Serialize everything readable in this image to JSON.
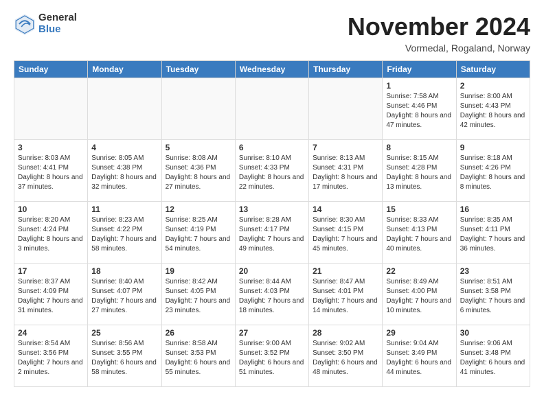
{
  "header": {
    "logo_general": "General",
    "logo_blue": "Blue",
    "month_title": "November 2024",
    "location": "Vormedal, Rogaland, Norway"
  },
  "days_of_week": [
    "Sunday",
    "Monday",
    "Tuesday",
    "Wednesday",
    "Thursday",
    "Friday",
    "Saturday"
  ],
  "weeks": [
    [
      {
        "day": "",
        "info": ""
      },
      {
        "day": "",
        "info": ""
      },
      {
        "day": "",
        "info": ""
      },
      {
        "day": "",
        "info": ""
      },
      {
        "day": "",
        "info": ""
      },
      {
        "day": "1",
        "info": "Sunrise: 7:58 AM\nSunset: 4:46 PM\nDaylight: 8 hours\nand 47 minutes."
      },
      {
        "day": "2",
        "info": "Sunrise: 8:00 AM\nSunset: 4:43 PM\nDaylight: 8 hours\nand 42 minutes."
      }
    ],
    [
      {
        "day": "3",
        "info": "Sunrise: 8:03 AM\nSunset: 4:41 PM\nDaylight: 8 hours\nand 37 minutes."
      },
      {
        "day": "4",
        "info": "Sunrise: 8:05 AM\nSunset: 4:38 PM\nDaylight: 8 hours\nand 32 minutes."
      },
      {
        "day": "5",
        "info": "Sunrise: 8:08 AM\nSunset: 4:36 PM\nDaylight: 8 hours\nand 27 minutes."
      },
      {
        "day": "6",
        "info": "Sunrise: 8:10 AM\nSunset: 4:33 PM\nDaylight: 8 hours\nand 22 minutes."
      },
      {
        "day": "7",
        "info": "Sunrise: 8:13 AM\nSunset: 4:31 PM\nDaylight: 8 hours\nand 17 minutes."
      },
      {
        "day": "8",
        "info": "Sunrise: 8:15 AM\nSunset: 4:28 PM\nDaylight: 8 hours\nand 13 minutes."
      },
      {
        "day": "9",
        "info": "Sunrise: 8:18 AM\nSunset: 4:26 PM\nDaylight: 8 hours\nand 8 minutes."
      }
    ],
    [
      {
        "day": "10",
        "info": "Sunrise: 8:20 AM\nSunset: 4:24 PM\nDaylight: 8 hours\nand 3 minutes."
      },
      {
        "day": "11",
        "info": "Sunrise: 8:23 AM\nSunset: 4:22 PM\nDaylight: 7 hours\nand 58 minutes."
      },
      {
        "day": "12",
        "info": "Sunrise: 8:25 AM\nSunset: 4:19 PM\nDaylight: 7 hours\nand 54 minutes."
      },
      {
        "day": "13",
        "info": "Sunrise: 8:28 AM\nSunset: 4:17 PM\nDaylight: 7 hours\nand 49 minutes."
      },
      {
        "day": "14",
        "info": "Sunrise: 8:30 AM\nSunset: 4:15 PM\nDaylight: 7 hours\nand 45 minutes."
      },
      {
        "day": "15",
        "info": "Sunrise: 8:33 AM\nSunset: 4:13 PM\nDaylight: 7 hours\nand 40 minutes."
      },
      {
        "day": "16",
        "info": "Sunrise: 8:35 AM\nSunset: 4:11 PM\nDaylight: 7 hours\nand 36 minutes."
      }
    ],
    [
      {
        "day": "17",
        "info": "Sunrise: 8:37 AM\nSunset: 4:09 PM\nDaylight: 7 hours\nand 31 minutes."
      },
      {
        "day": "18",
        "info": "Sunrise: 8:40 AM\nSunset: 4:07 PM\nDaylight: 7 hours\nand 27 minutes."
      },
      {
        "day": "19",
        "info": "Sunrise: 8:42 AM\nSunset: 4:05 PM\nDaylight: 7 hours\nand 23 minutes."
      },
      {
        "day": "20",
        "info": "Sunrise: 8:44 AM\nSunset: 4:03 PM\nDaylight: 7 hours\nand 18 minutes."
      },
      {
        "day": "21",
        "info": "Sunrise: 8:47 AM\nSunset: 4:01 PM\nDaylight: 7 hours\nand 14 minutes."
      },
      {
        "day": "22",
        "info": "Sunrise: 8:49 AM\nSunset: 4:00 PM\nDaylight: 7 hours\nand 10 minutes."
      },
      {
        "day": "23",
        "info": "Sunrise: 8:51 AM\nSunset: 3:58 PM\nDaylight: 7 hours\nand 6 minutes."
      }
    ],
    [
      {
        "day": "24",
        "info": "Sunrise: 8:54 AM\nSunset: 3:56 PM\nDaylight: 7 hours\nand 2 minutes."
      },
      {
        "day": "25",
        "info": "Sunrise: 8:56 AM\nSunset: 3:55 PM\nDaylight: 6 hours\nand 58 minutes."
      },
      {
        "day": "26",
        "info": "Sunrise: 8:58 AM\nSunset: 3:53 PM\nDaylight: 6 hours\nand 55 minutes."
      },
      {
        "day": "27",
        "info": "Sunrise: 9:00 AM\nSunset: 3:52 PM\nDaylight: 6 hours\nand 51 minutes."
      },
      {
        "day": "28",
        "info": "Sunrise: 9:02 AM\nSunset: 3:50 PM\nDaylight: 6 hours\nand 48 minutes."
      },
      {
        "day": "29",
        "info": "Sunrise: 9:04 AM\nSunset: 3:49 PM\nDaylight: 6 hours\nand 44 minutes."
      },
      {
        "day": "30",
        "info": "Sunrise: 9:06 AM\nSunset: 3:48 PM\nDaylight: 6 hours\nand 41 minutes."
      }
    ]
  ]
}
